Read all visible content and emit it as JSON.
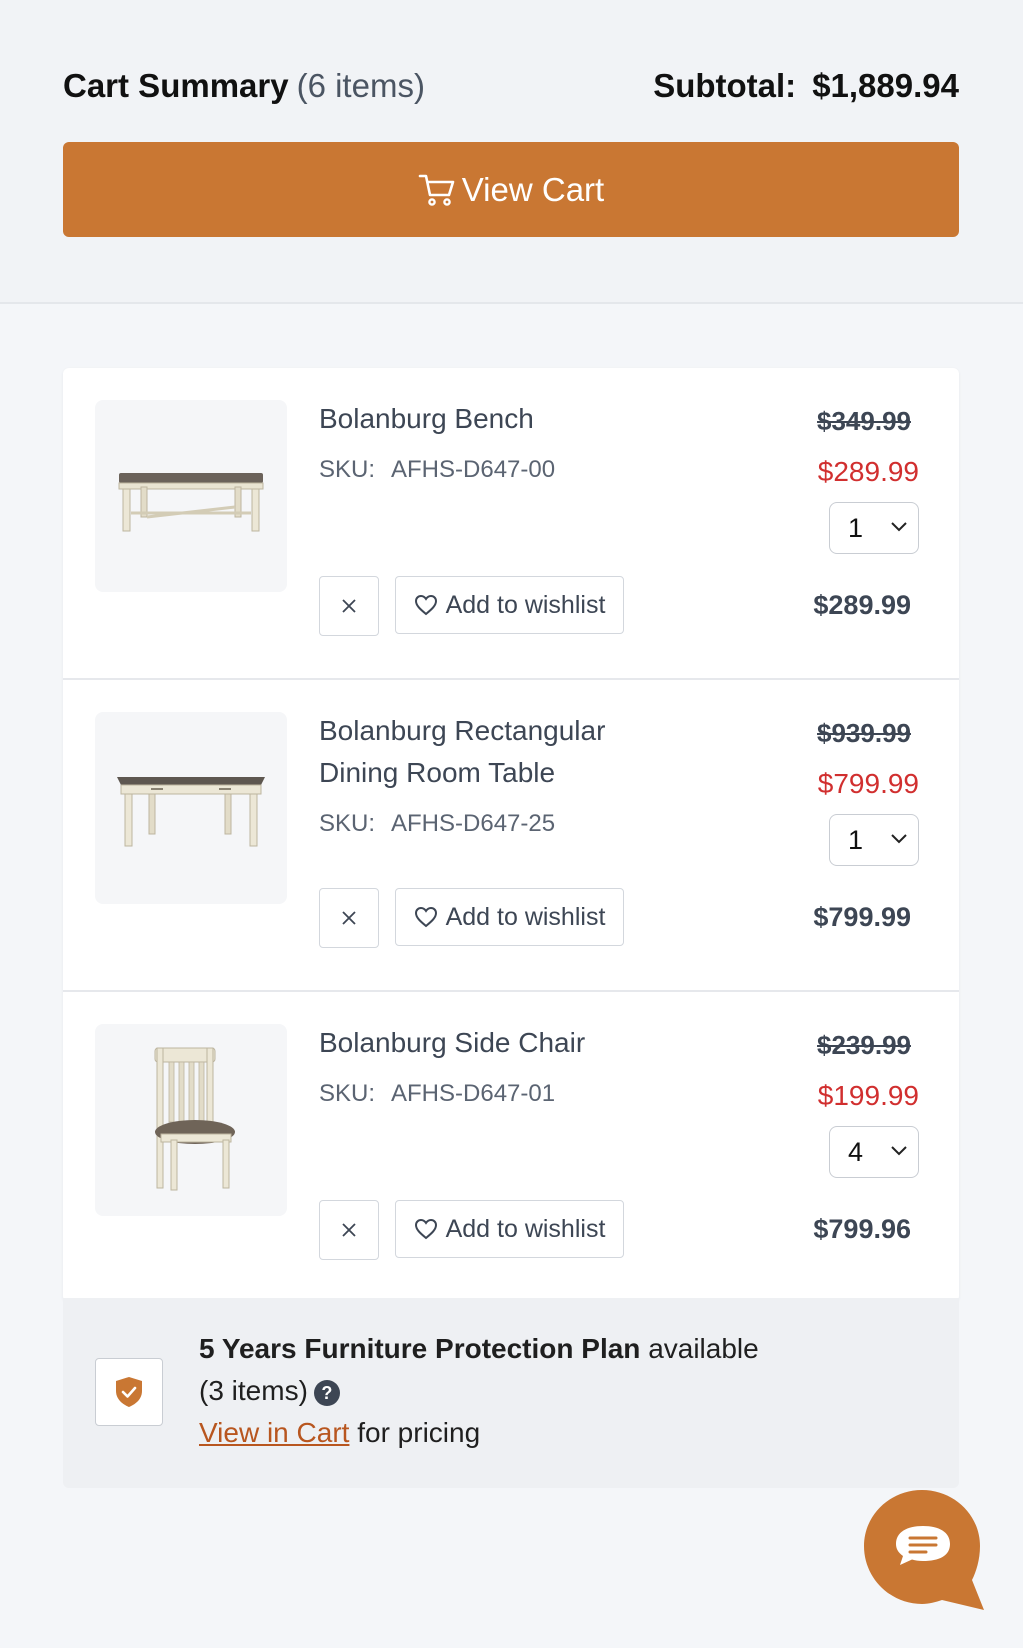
{
  "header": {
    "title": "Cart Summary",
    "count": "(6 items)",
    "subtotal_label": "Subtotal:",
    "subtotal_value": "$1,889.94",
    "view_cart_label": "View Cart"
  },
  "items": [
    {
      "name": "Bolanburg Bench",
      "sku_label": "SKU:",
      "sku": "AFHS-D647-00",
      "original_price": "$349.99",
      "sale_price": "$289.99",
      "quantity": "1",
      "line_total": "$289.99",
      "wishlist_label": "Add to wishlist"
    },
    {
      "name": "Bolanburg Rectangular Dining Room Table",
      "sku_label": "SKU:",
      "sku": "AFHS-D647-25",
      "original_price": "$939.99",
      "sale_price": "$799.99",
      "quantity": "1",
      "line_total": "$799.99",
      "wishlist_label": "Add to wishlist"
    },
    {
      "name": "Bolanburg Side Chair",
      "sku_label": "SKU:",
      "sku": "AFHS-D647-01",
      "original_price": "$239.99",
      "sale_price": "$199.99",
      "quantity": "4",
      "line_total": "$799.96",
      "wishlist_label": "Add to wishlist"
    }
  ],
  "protection": {
    "title": "5 Years Furniture Protection Plan",
    "available": "available",
    "count": "(3 items)",
    "help": "?",
    "link": "View in Cart",
    "suffix": "for pricing"
  },
  "colors": {
    "accent": "#c97733",
    "sale": "#d12f2f",
    "link": "#b8561f"
  }
}
